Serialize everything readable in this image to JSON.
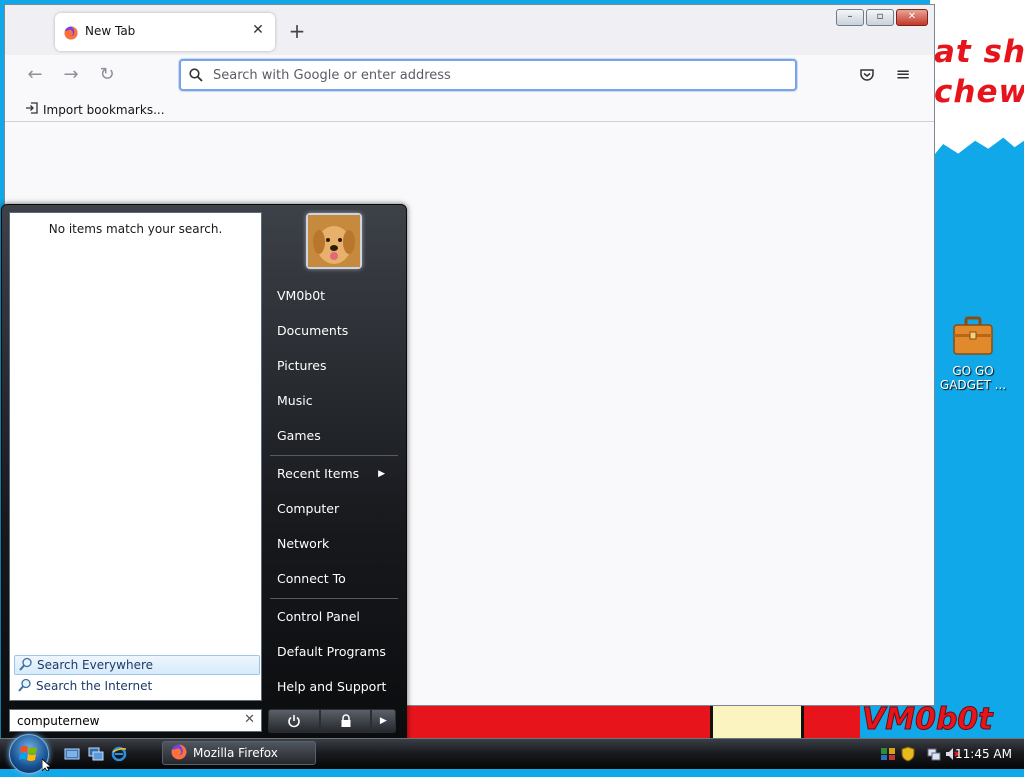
{
  "desktop": {
    "wallpaper_text_lines": [
      "at shit",
      "chew"
    ],
    "wallpaper_signature": "VM0b0t",
    "icon_label_lines": [
      "GO GO",
      "GADGET ..."
    ]
  },
  "firefox": {
    "tab_title": "New Tab",
    "urlbar_placeholder": "Search with Google or enter address",
    "import_bookmarks_label": "Import bookmarks..."
  },
  "start_menu": {
    "no_results": "No items match your search.",
    "search_options": [
      "Search Everywhere",
      "Search the Internet"
    ],
    "search_value": "computernew",
    "user_name": "VM0b0t",
    "right_items": [
      "Documents",
      "Pictures",
      "Music",
      "Games",
      "Recent Items",
      "Computer",
      "Network",
      "Connect To",
      "Control Panel",
      "Default Programs",
      "Help and Support"
    ]
  },
  "taskbar": {
    "task_label": "Mozilla Firefox",
    "clock": "11:45 AM"
  },
  "colors": {
    "desktop_blue": "#10a8e8",
    "wallpaper_red": "#e8141c",
    "url_focus": "#7ba4e3"
  }
}
